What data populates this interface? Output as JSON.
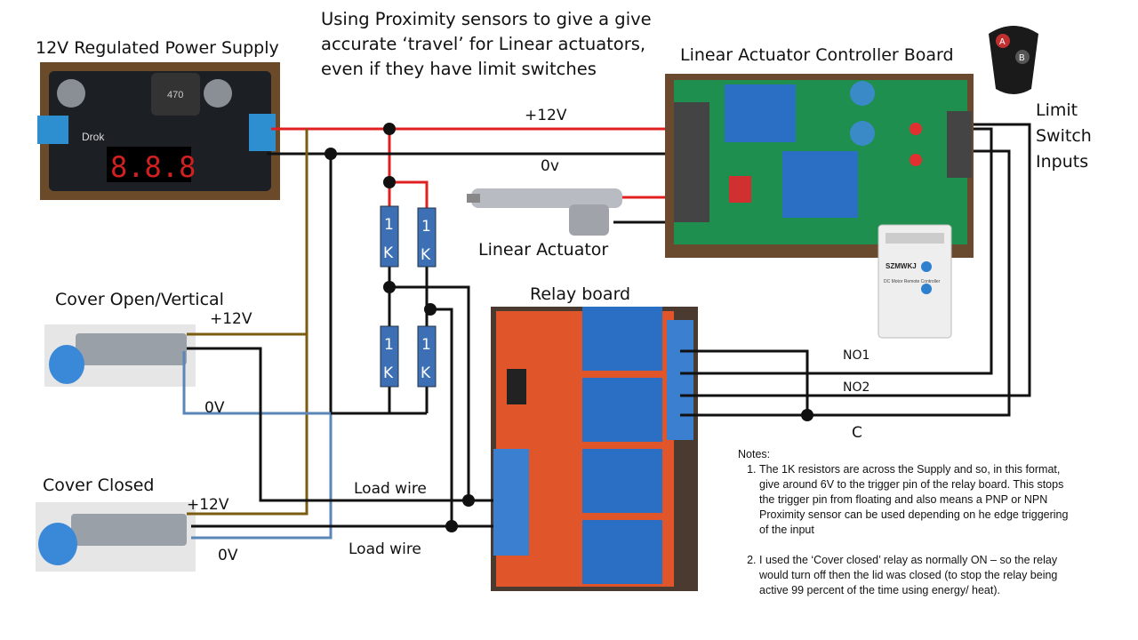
{
  "title": [
    "Using Proximity sensors to give a give",
    "accurate ‘travel’ for Linear actuators,",
    "even if they have limit switches"
  ],
  "components": {
    "power_supply": "12V Regulated Power Supply",
    "power_supply_display": "8.8.8",
    "power_supply_brand": "Drok",
    "controller": "Linear Actuator Controller Board",
    "limit_inputs": [
      "Limit",
      "Switch",
      "Inputs"
    ],
    "actuator": "Linear Actuator",
    "relay_board": "Relay board",
    "sensor_open": "Cover Open/Vertical",
    "sensor_closed": "Cover Closed",
    "remote_box_brand": "SZMWKJ",
    "remote_box_text": "DC Motor Remote Controller",
    "fob_buttons": [
      "A",
      "B"
    ]
  },
  "wire_labels": {
    "supply_pos": "+12V",
    "supply_neg": "0v",
    "open_pos": "+12V",
    "open_neg": "0V",
    "closed_pos": "+12V",
    "closed_neg": "0V",
    "load1": "Load wire",
    "load2": "Load wire",
    "no1": "NO1",
    "no2": "NO2",
    "c": "C"
  },
  "resistors": [
    {
      "top": "1",
      "bottom": "K"
    },
    {
      "top": "1",
      "bottom": "K"
    },
    {
      "top": "1",
      "bottom": "K"
    },
    {
      "top": "1",
      "bottom": "K"
    }
  ],
  "notes": {
    "heading": "Notes:",
    "items": [
      "The 1K resistors are across the Supply and so, in this format, give around 6V to the trigger pin of the relay board. This stops the trigger pin from floating and also means a PNP or NPN Proximity sensor can be used depending on he edge triggering of the input",
      "I used the ‘Cover closed’ relay as normally ON – so the relay would turn off then the lid was closed (to stop the relay being active 99 percent of the time using energy/ heat)."
    ]
  },
  "colors": {
    "positive_wire": "#e02020",
    "negative_wire": "#111111",
    "sensor_pos_wire": "#7a5c10",
    "sensor_neg_wire": "#5b86b8",
    "resistor": "#3d6fb5"
  }
}
